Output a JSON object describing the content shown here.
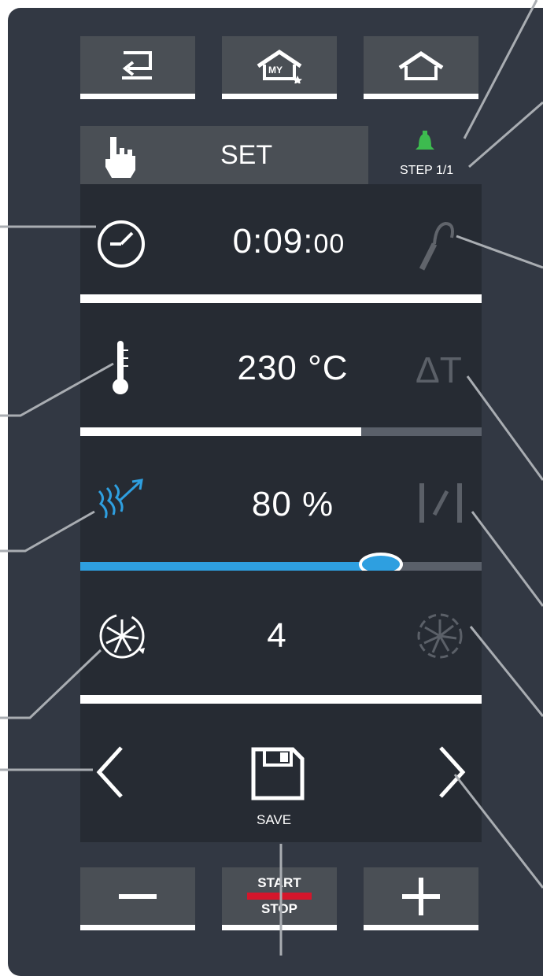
{
  "top_bar": {
    "back_icon": "back-arrow-icon",
    "my_home_label": "MY",
    "home_icon": "home-icon"
  },
  "mode": {
    "label": "SET",
    "icon": "hand-pointer-icon"
  },
  "step": {
    "label": "STEP 1/1",
    "icon": "bell-icon",
    "icon_color": "#3dbb4f"
  },
  "time": {
    "hm": "0:09:",
    "s": "00",
    "icon": "clock-icon",
    "secondary_icon": "core-probe-icon"
  },
  "temperature": {
    "value": "230 °C",
    "icon": "thermometer-icon",
    "secondary_icon": "delta-t-icon",
    "delta_label": "ΔT",
    "level_fraction": 0.7
  },
  "humidity": {
    "value": "80 %",
    "icon": "steam-icon",
    "secondary_icon": "damper-icon",
    "level_fraction": 0.75,
    "accent": "#2e9fe0"
  },
  "fan": {
    "value": "4",
    "icon": "fan-speed-icon",
    "secondary_icon": "fan-pulse-icon"
  },
  "navigation": {
    "save_label": "SAVE"
  },
  "bottom_bar": {
    "start_label": "START",
    "stop_label": "STOP",
    "start_stop_accent": "#d5162b"
  }
}
